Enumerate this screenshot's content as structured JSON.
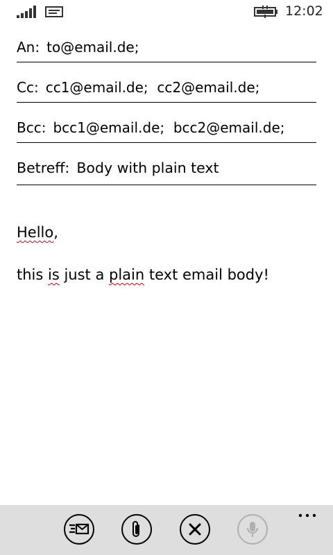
{
  "status_bar": {
    "time": "12:02",
    "signal_icon": "signal-bars-icon",
    "message_icon": "message-notification-icon",
    "battery_icon": "battery-charging-icon"
  },
  "fields": {
    "to": {
      "label": "An:",
      "value": "to@email.de;"
    },
    "cc": {
      "label": "Cc:",
      "value": "cc1@email.de;  cc2@email.de;"
    },
    "bcc": {
      "label": "Bcc:",
      "value": "bcc1@email.de;  bcc2@email.de;"
    },
    "subject": {
      "label": "Betreff:",
      "value": "Body with plain text"
    }
  },
  "body": {
    "line1_word": "Hello",
    "line1_rest": ",",
    "line2_a": "this ",
    "line2_b": "is",
    "line2_c": " just a ",
    "line2_d": "plain",
    "line2_e": " text email body!"
  },
  "app_bar": {
    "buttons": [
      {
        "name": "send",
        "icon": "send-mail-icon",
        "enabled": true
      },
      {
        "name": "attach",
        "icon": "paperclip-icon",
        "enabled": true
      },
      {
        "name": "discard",
        "icon": "close-icon",
        "enabled": true
      },
      {
        "name": "voice",
        "icon": "microphone-icon",
        "enabled": false
      }
    ],
    "more_icon": "ellipsis-icon"
  },
  "colors": {
    "app_bar_bg": "#dedede",
    "spellcheck": "#d40000",
    "disabled": "#b0b0b0"
  }
}
